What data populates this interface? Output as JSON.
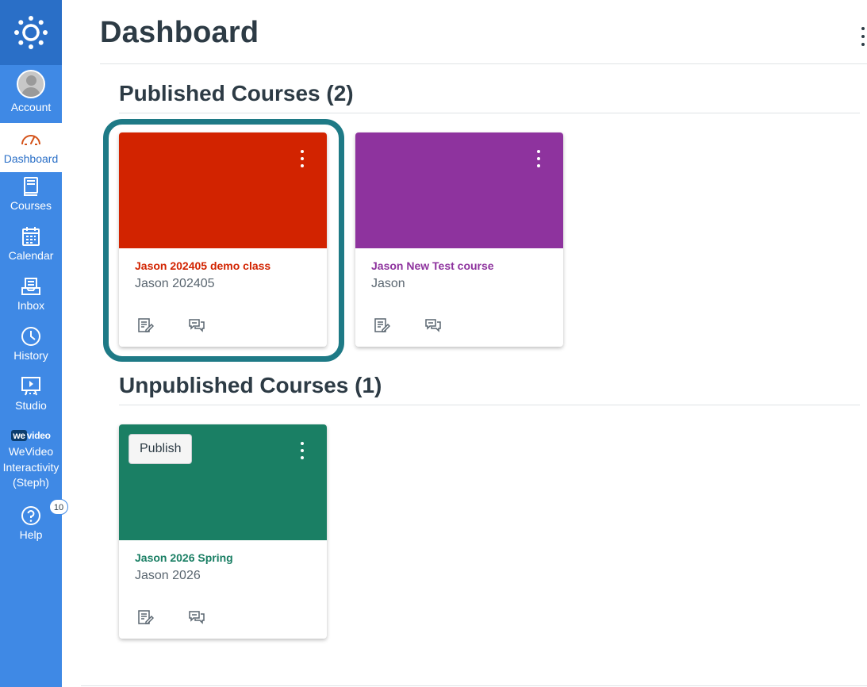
{
  "nav": {
    "items": [
      {
        "label": "Account"
      },
      {
        "label": "Dashboard"
      },
      {
        "label": "Courses"
      },
      {
        "label": "Calendar"
      },
      {
        "label": "Inbox"
      },
      {
        "label": "History"
      },
      {
        "label": "Studio"
      },
      {
        "label": "WeVideo Interactivity (Steph)",
        "logo_we": "we",
        "logo_rest": "video"
      },
      {
        "label": "Help",
        "badge": "10"
      }
    ],
    "colors": {
      "background": "#3f89e5",
      "logo_bg": "#2a6fc7",
      "active_text": "#2a6fc7"
    }
  },
  "header": {
    "title": "Dashboard"
  },
  "sections": {
    "published": {
      "title": "Published Courses (2)"
    },
    "unpublished": {
      "title": "Unpublished Courses (1)"
    }
  },
  "cards": [
    {
      "name": "Jason 202405 demo class",
      "term": "Jason 202405",
      "color": "#d22300",
      "focused": true
    },
    {
      "name": "Jason New Test course",
      "term": "Jason",
      "color": "#8e339e"
    },
    {
      "name": "Jason 2026 Spring",
      "term": "Jason 2026",
      "color": "#1a7f64",
      "publish_label": "Publish"
    }
  ],
  "icons": {
    "logo": "canvas-logo-icon",
    "card_actions": [
      "assignments-icon",
      "discussions-icon"
    ],
    "options": "kebab-menu-icon"
  }
}
